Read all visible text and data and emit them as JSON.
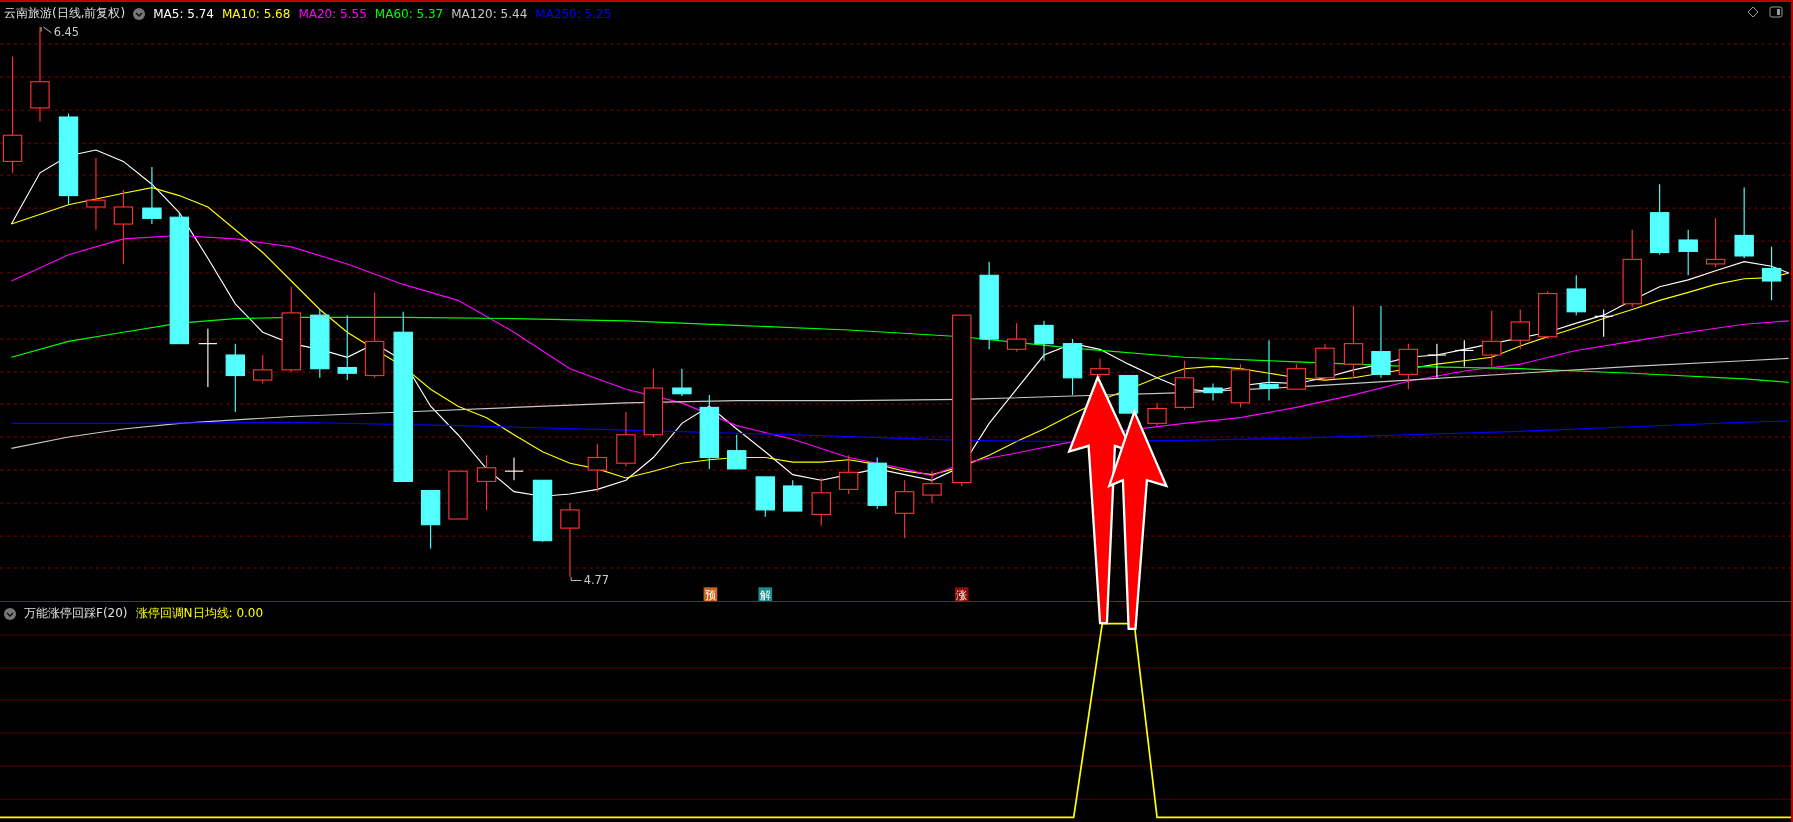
{
  "main_chart": {
    "title": "云南旅游(日线,前复权)",
    "legend": [
      {
        "label": "MA5: 5.74",
        "color": "#ffffff"
      },
      {
        "label": "MA10: 5.68",
        "color": "#ffff00"
      },
      {
        "label": "MA20: 5.55",
        "color": "#ff00ff"
      },
      {
        "label": "MA60: 5.37",
        "color": "#00ff00"
      },
      {
        "label": "MA120: 5.44",
        "color": "#c8c8c8"
      },
      {
        "label": "MA250: 5.25",
        "color": "#0000ff"
      }
    ],
    "price_marks": [
      "6.45",
      "4.77"
    ],
    "signals": [
      {
        "label": "预",
        "color": "#c8641e"
      },
      {
        "label": "解",
        "color": "#1e8c8c"
      },
      {
        "label": "涨",
        "color": "#8c0a0a"
      }
    ]
  },
  "indicator": {
    "name": "万能涨停回踩F(20)",
    "legend": [
      {
        "label": "涨停回调N日均线: 0.00",
        "color": "#ffff00"
      }
    ]
  }
}
